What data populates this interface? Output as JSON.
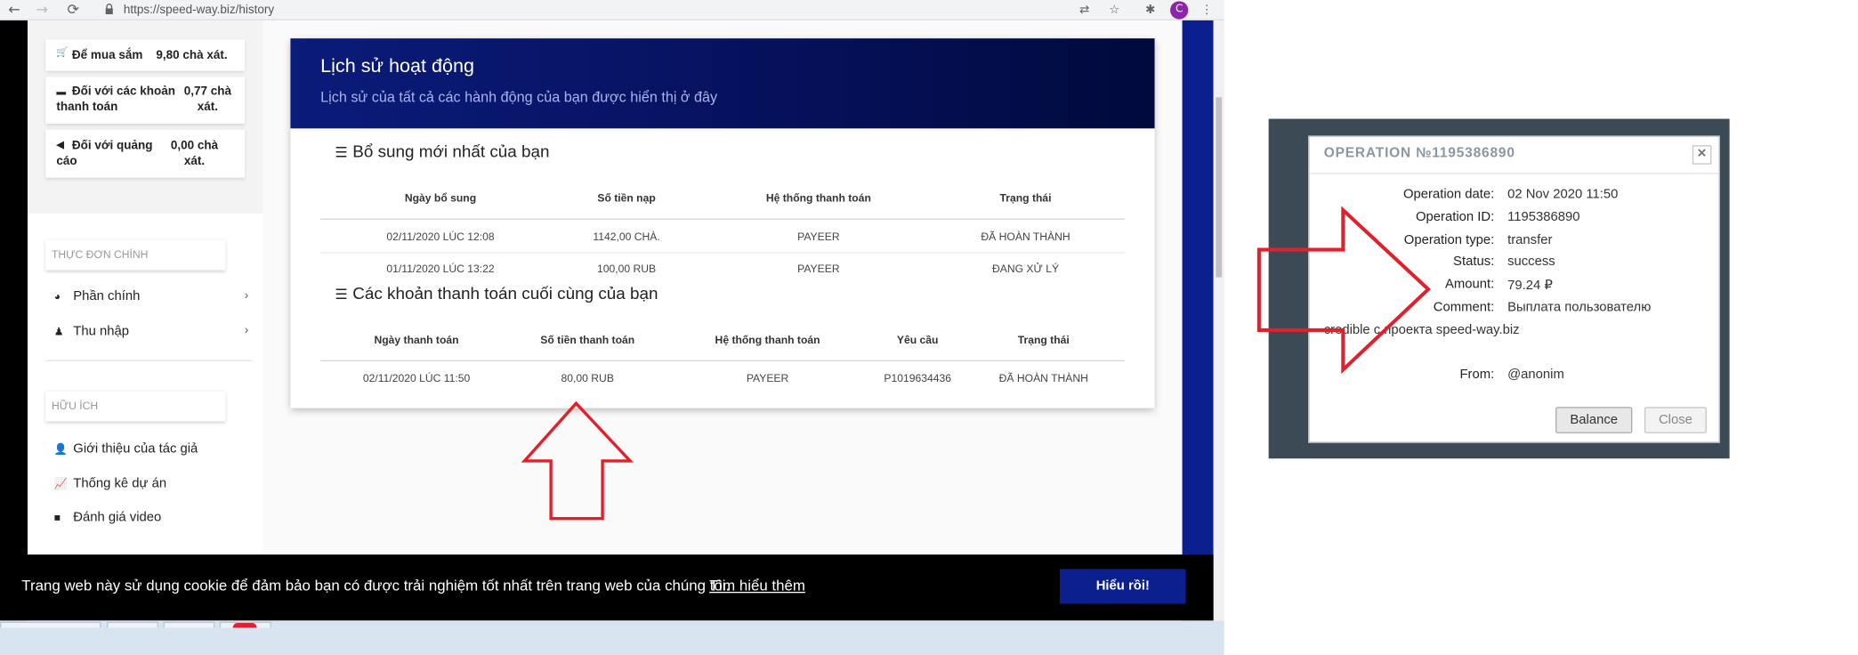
{
  "browser": {
    "back_icon": "←",
    "forward_icon": "→",
    "reload_icon": "⟳",
    "url": "https://speed-way.biz/history",
    "translate_icon": "⇄",
    "star_icon": "☆",
    "extensions_icon": "✱",
    "profile_letter": "C",
    "menu_icon": "⋮"
  },
  "sidebar": {
    "balances": [
      {
        "icon": "🛒",
        "label": "Để mua sắm",
        "value": "9,80 chà xát."
      },
      {
        "icon": "▬",
        "label": "Đối với các khoản thanh toán",
        "value": "0,77 chà xát."
      },
      {
        "icon": "◀",
        "label": "Đối với quảng cáo",
        "value": "0,00 chà xát."
      }
    ],
    "main_menu_title": "THỰC ĐƠN CHÍNH",
    "main_menu": [
      {
        "icon": "◕",
        "label": "Phần chính",
        "chevron": "›"
      },
      {
        "icon": "♟",
        "label": "Thu nhập",
        "chevron": "›"
      }
    ],
    "useful_title": "HỮU ÍCH",
    "useful_menu": [
      {
        "icon": "👤",
        "label": "Giới thiệu của tác giả"
      },
      {
        "icon": "📈",
        "label": "Thống kê dự án"
      },
      {
        "icon": "■",
        "label": "Đánh giá video"
      }
    ]
  },
  "history": {
    "title": "Lịch sử hoạt động",
    "subtitle": "Lịch sử của tất cả các hành động của bạn được hiển thị ở đây",
    "list_icon": "☰",
    "deposits_title": "Bổ sung mới nhất của bạn",
    "deposits_headers": [
      "Ngày bổ sung",
      "Số tiền nạp",
      "Hệ thống thanh toán",
      "Trạng thái"
    ],
    "deposits_rows": [
      [
        "02/11/2020 LÚC 12:08",
        "1142,00 CHÀ.",
        "PAYEER",
        "ĐÃ HOÀN THÀNH"
      ],
      [
        "01/11/2020 LÚC 13:22",
        "100,00 RUB",
        "PAYEER",
        "ĐANG XỬ LÝ"
      ]
    ],
    "payouts_title": "Các khoản thanh toán cuối cùng của bạn",
    "payouts_headers": [
      "Ngày thanh toán",
      "Số tiền thanh toán",
      "Hệ thống thanh toán",
      "Yêu cầu",
      "Trạng thái"
    ],
    "payouts_rows": [
      [
        "02/11/2020 LÚC 11:50",
        "80,00 RUB",
        "PAYEER",
        "P1019634436",
        "ĐÃ HOÀN THÀNH"
      ]
    ]
  },
  "cookie": {
    "message": "Trang web này sử dụng cookie để đảm bảo bạn có được trải nghiệm tốt nhất trên trang web của chúng tôi.",
    "link": "Tìm hiểu thêm",
    "button": "Hiểu rồi!"
  },
  "operation": {
    "title": "OPERATION №1195386890",
    "close_icon": "✕",
    "fields": [
      {
        "label": "Operation date:",
        "value": "02 Nov 2020 11:50"
      },
      {
        "label": "Operation ID:",
        "value": "1195386890"
      },
      {
        "label": "Operation type:",
        "value": "transfer"
      },
      {
        "label": "Status:",
        "value": "success"
      },
      {
        "label": "Amount:",
        "value": "79.24 ₽"
      },
      {
        "label": "Comment:",
        "value": "Выплата пользователю"
      }
    ],
    "comment_continued": "credible с проекта speed-way.biz",
    "from_label": "From:",
    "from_value": "@anonim",
    "balance_button": "Balance",
    "close_button": "Close"
  },
  "colors": {
    "header_blue": "#0a1b7a",
    "annotation_red": "#e0202a",
    "cookie_button": "#0b1f8f"
  }
}
